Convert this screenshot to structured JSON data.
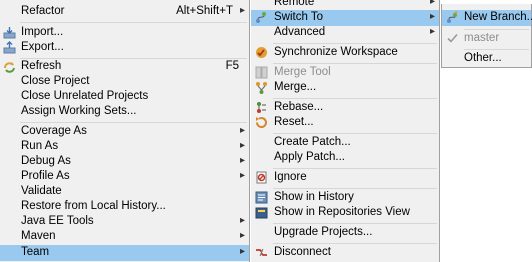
{
  "team_menu": {
    "refactor": {
      "label": "Refactor",
      "shortcut": "Alt+Shift+T"
    },
    "import": "Import...",
    "export": "Export...",
    "refresh": {
      "label": "Refresh",
      "shortcut": "F5"
    },
    "close_project": "Close Project",
    "close_unrelated": "Close Unrelated Projects",
    "assign_working_sets": "Assign Working Sets...",
    "coverage_as": "Coverage As",
    "run_as": "Run As",
    "debug_as": "Debug As",
    "profile_as": "Profile As",
    "validate": "Validate",
    "restore_history": "Restore from Local History...",
    "java_ee_tools": "Java EE Tools",
    "maven": "Maven",
    "team": "Team"
  },
  "submenu": {
    "remote": "Remote",
    "switch_to": "Switch To",
    "advanced": "Advanced",
    "synchronize": "Synchronize Workspace",
    "merge_tool": "Merge Tool",
    "merge": "Merge...",
    "rebase": "Rebase...",
    "reset": "Reset...",
    "create_patch": "Create Patch...",
    "apply_patch": "Apply Patch...",
    "ignore": "Ignore",
    "show_history": "Show in History",
    "show_repositories": "Show in Repositories View",
    "upgrade_projects": "Upgrade Projects...",
    "disconnect": "Disconnect"
  },
  "switch_menu": {
    "new_branch": "New Branch...",
    "master": "master",
    "other": "Other..."
  },
  "colors": {
    "menu_bg": "#f0f0f0",
    "highlight": "#99c9ef",
    "disabled_text": "#8d8d8d"
  }
}
